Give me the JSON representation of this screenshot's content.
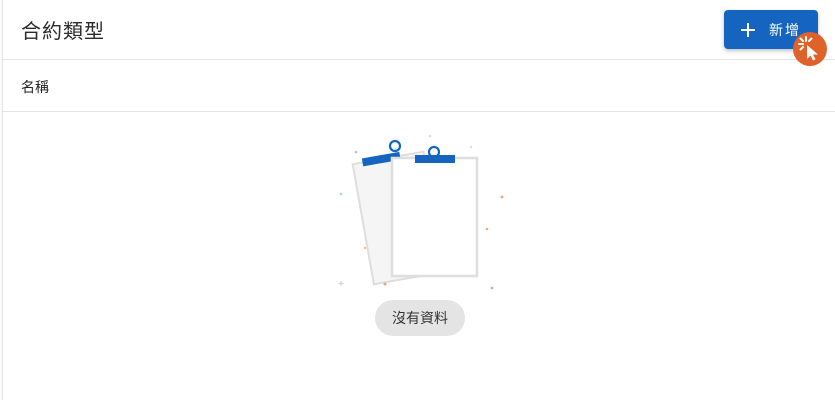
{
  "header": {
    "title": "合約類型",
    "add_button_label": "新增"
  },
  "table": {
    "columns": [
      "名稱"
    ]
  },
  "empty_state": {
    "message": "沒有資料"
  },
  "colors": {
    "primary": "#1565c0",
    "click_indicator": "#e0622b",
    "badge_bg": "#e4e4e4"
  },
  "icons": {
    "add": "plus-icon",
    "empty": "clipboard-empty-illustration",
    "cursor": "click-cursor-icon"
  }
}
